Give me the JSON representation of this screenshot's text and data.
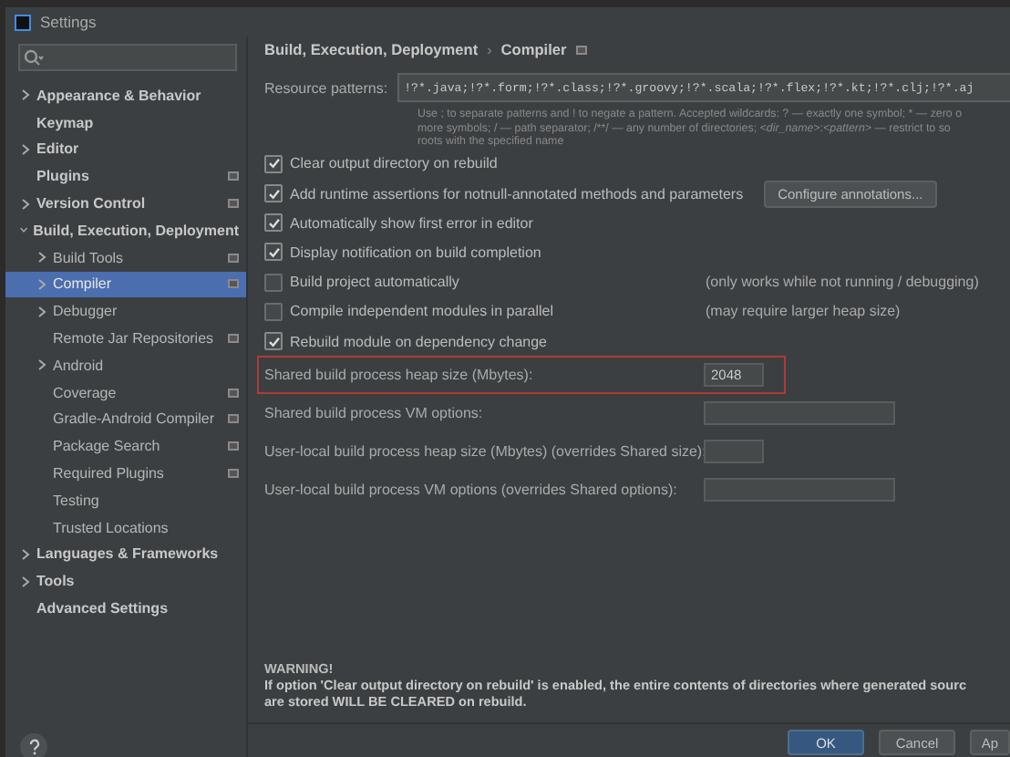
{
  "window": {
    "title": "Settings"
  },
  "sidebar": {
    "items": [
      {
        "label": "Appearance & Behavior",
        "expanded": false,
        "selected": false,
        "settings_icon": false
      },
      {
        "label": "Keymap",
        "selected": false,
        "settings_icon": false
      },
      {
        "label": "Editor",
        "expanded": false,
        "selected": false,
        "settings_icon": false
      },
      {
        "label": "Plugins",
        "selected": false,
        "settings_icon": true
      },
      {
        "label": "Version Control",
        "expanded": false,
        "selected": false,
        "settings_icon": true
      },
      {
        "label": "Build, Execution, Deployment",
        "expanded": true,
        "selected": false,
        "settings_icon": false,
        "children": [
          {
            "label": "Build Tools",
            "expanded": false,
            "selected": false,
            "settings_icon": true
          },
          {
            "label": "Compiler",
            "expanded": false,
            "selected": true,
            "settings_icon": true
          },
          {
            "label": "Debugger",
            "expanded": false,
            "selected": false,
            "settings_icon": false
          },
          {
            "label": "Remote Jar Repositories",
            "selected": false,
            "settings_icon": true
          },
          {
            "label": "Android",
            "expanded": false,
            "selected": false,
            "settings_icon": false
          },
          {
            "label": "Coverage",
            "selected": false,
            "settings_icon": true
          },
          {
            "label": "Gradle-Android Compiler",
            "selected": false,
            "settings_icon": true
          },
          {
            "label": "Package Search",
            "selected": false,
            "settings_icon": true
          },
          {
            "label": "Required Plugins",
            "selected": false,
            "settings_icon": true
          },
          {
            "label": "Testing",
            "selected": false,
            "settings_icon": false
          },
          {
            "label": "Trusted Locations",
            "selected": false,
            "settings_icon": false
          }
        ]
      },
      {
        "label": "Languages & Frameworks",
        "expanded": false,
        "selected": false,
        "settings_icon": false
      },
      {
        "label": "Tools",
        "expanded": false,
        "selected": false,
        "settings_icon": false
      },
      {
        "label": "Advanced Settings",
        "selected": false,
        "settings_icon": false
      }
    ]
  },
  "breadcrumb": [
    "Build, Execution, Deployment",
    "›",
    "Compiler"
  ],
  "resource_patterns": {
    "label": "Resource patterns:",
    "value": "!?*.java;!?*.form;!?*.class;!?*.groovy;!?*.scala;!?*.flex;!?*.kt;!?*.clj;!?*.aj",
    "hint_lines": [
      "Use ; to separate patterns and ! to negate a pattern. Accepted wildcards: ? — exactly one symbol; * — zero o",
      "more symbols; / — path separator; /**/ — any number of directories;  *<dir_name>*:*<pattern>* — restrict to so",
      "roots with the specified name"
    ]
  },
  "options": [
    {
      "label": "Clear output directory on rebuild",
      "checked": true
    },
    {
      "label": "Add runtime assertions for notnull-annotated methods and parameters",
      "checked": true,
      "button": "Configure annotations..."
    },
    {
      "label": "Automatically show first error in editor",
      "checked": true
    },
    {
      "label": "Display notification on build completion",
      "checked": true
    },
    {
      "label": "Build project automatically",
      "checked": false,
      "note": "(only works while not running / debugging)"
    },
    {
      "label": "Compile independent modules in parallel",
      "checked": false,
      "note": "(may require larger heap size)"
    },
    {
      "label": "Rebuild module on dependency change",
      "checked": true
    }
  ],
  "fields": [
    {
      "label": "Shared build process heap size (Mbytes):",
      "value": "2048",
      "kind": "short",
      "highlighted": true
    },
    {
      "label": "Shared build process VM options:",
      "kind": "wide",
      "highlighted": false
    },
    {
      "label": "User-local build process heap size (Mbytes) (overrides Shared size):",
      "kind": "short",
      "highlighted": false
    },
    {
      "label": "User-local build process VM options (overrides Shared options):",
      "kind": "wide",
      "highlighted": false
    }
  ],
  "warning": {
    "title": "WARNING!",
    "lines": [
      "If option 'Clear output directory on rebuild' is enabled, the entire contents of directories where generated sourc",
      "are stored WILL BE CLEARED on rebuild."
    ]
  },
  "buttons": [
    {
      "label": "OK",
      "kind": "primary"
    },
    {
      "label": "Cancel",
      "kind": "normal"
    },
    {
      "label": "Ap",
      "kind": "normal"
    }
  ]
}
